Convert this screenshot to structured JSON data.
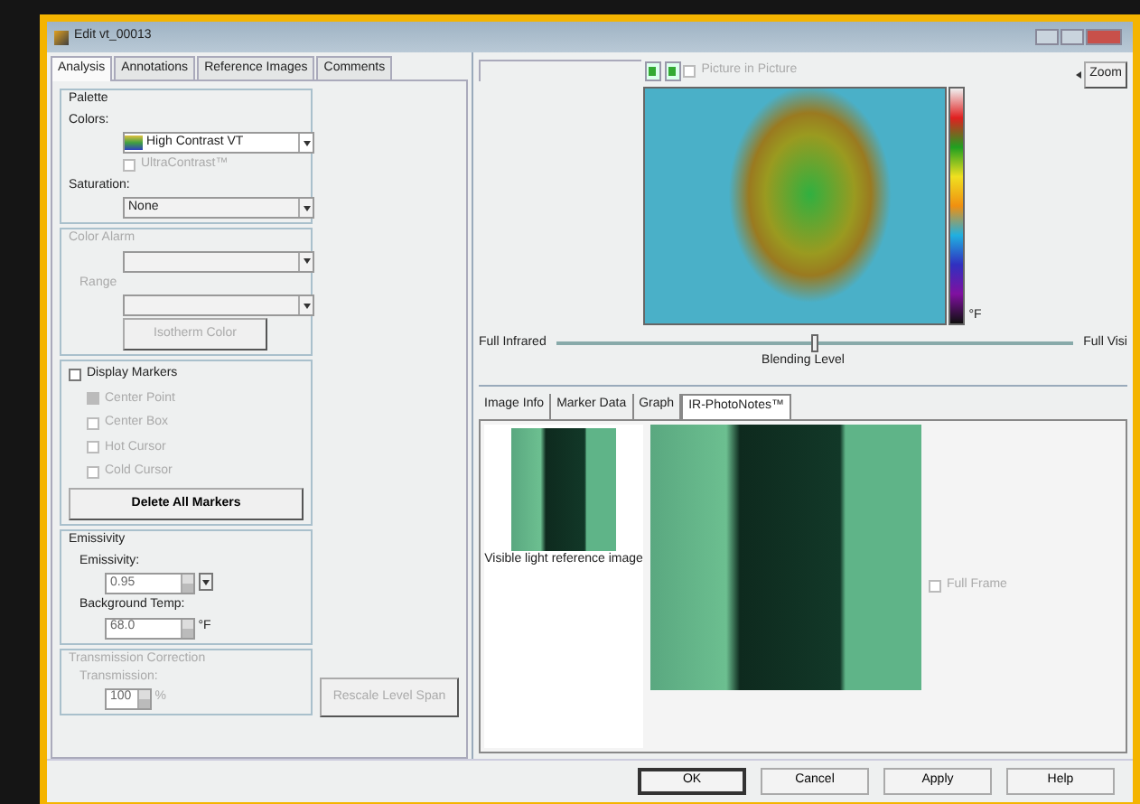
{
  "window": {
    "title": "Edit vt_00013"
  },
  "tabs": [
    {
      "label": "Analysis",
      "selected": true
    },
    {
      "label": "Annotations",
      "selected": false
    },
    {
      "label": "Reference Images",
      "selected": false
    },
    {
      "label": "Comments",
      "selected": false
    }
  ],
  "palette": {
    "legend": "Palette",
    "colors_label": "Colors:",
    "colors_value": "High Contrast VT",
    "ultracontrast": {
      "label": "UltraContrast™",
      "checked": false,
      "disabled": true
    },
    "saturation_label": "Saturation:",
    "saturation_value": "None"
  },
  "color_alarm": {
    "legend": "Color Alarm",
    "range_label": "Range",
    "button": "Isotherm Color",
    "disabled": true
  },
  "display_markers": {
    "label": "Display Markers",
    "checked": false,
    "items": [
      {
        "label": "Center Point",
        "checked": true
      },
      {
        "label": "Center Box",
        "checked": false
      },
      {
        "label": "Hot Cursor",
        "checked": false
      },
      {
        "label": "Cold Cursor",
        "checked": false
      }
    ],
    "button": "Delete All Markers"
  },
  "emissivity": {
    "legend": "Emissivity",
    "emissivity_label": "Emissivity:",
    "emissivity_value": "0.95",
    "background_label": "Background Temp:",
    "background_value": "68.0",
    "unit": "°F"
  },
  "transmission": {
    "legend": "Transmission Correction",
    "label": "Transmission:",
    "value": "100",
    "unit": "%"
  },
  "rescale_button": "Rescale Level Span",
  "picture_in_picture": {
    "label": "Picture in Picture",
    "checked": false
  },
  "zoom_label": "Zoom",
  "scale_unit": "°F",
  "blending": {
    "left_label": "Full Infrared",
    "right_label": "Full Visi",
    "caption": "Blending Level",
    "level": 0.5
  },
  "bottom_tabs": [
    {
      "label": "Image Info",
      "selected": false
    },
    {
      "label": "Marker Data",
      "selected": false
    },
    {
      "label": "Graph",
      "selected": false
    },
    {
      "label": "IR-PhotoNotes™",
      "selected": true
    }
  ],
  "thumbnail_caption": "Visible light reference image",
  "full_frame": {
    "label": "Full Frame",
    "checked": false
  },
  "buttons": [
    {
      "label": "OK",
      "default": true
    },
    {
      "label": "Cancel",
      "default": false
    },
    {
      "label": "Apply",
      "default": false
    },
    {
      "label": "Help",
      "default": false
    }
  ]
}
